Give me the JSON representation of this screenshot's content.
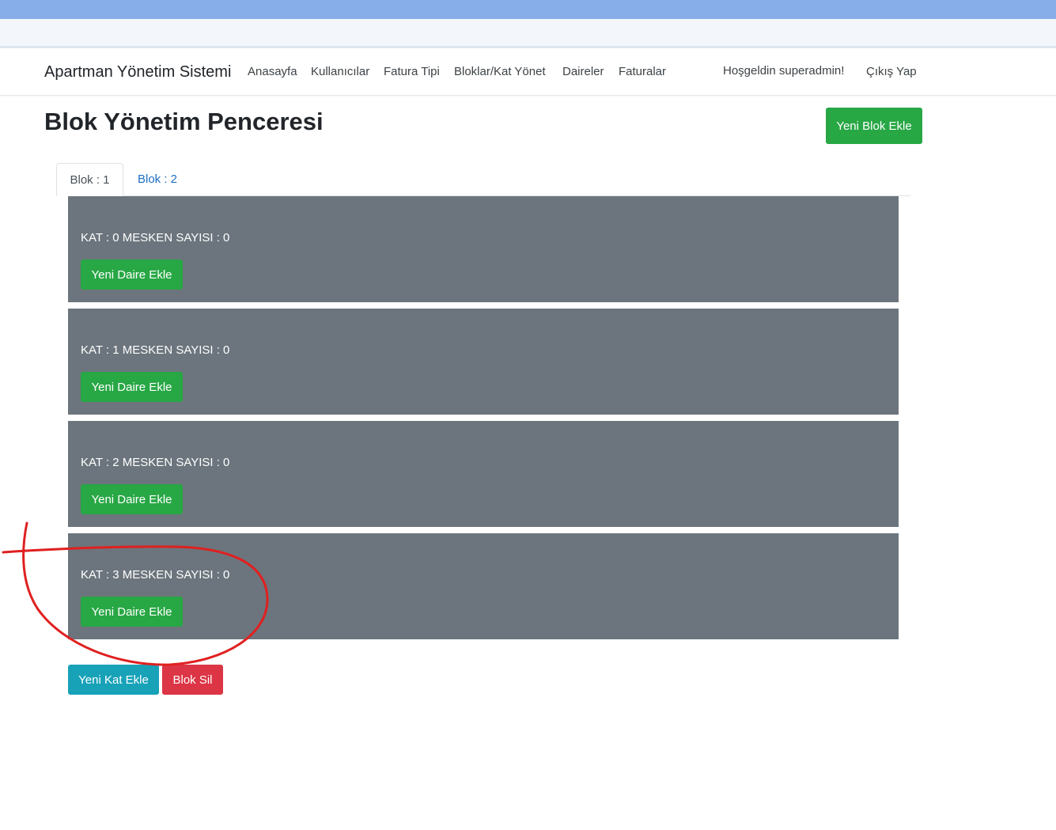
{
  "navbar": {
    "brand": "Apartman Yönetim Sistemi",
    "links": [
      "Anasayfa",
      "Kullanıcılar",
      "Fatura Tipi",
      "Bloklar/Kat Yönet",
      "Daireler",
      "Faturalar"
    ],
    "welcome": "Hoşgeldin superadmin!",
    "logout": "Çıkış Yap"
  },
  "page": {
    "title": "Blok Yönetim Penceresi",
    "new_block_label": "Yeni Blok Ekle"
  },
  "tabs": [
    {
      "label": "Blok : 1",
      "active": true
    },
    {
      "label": "Blok : 2",
      "active": false
    }
  ],
  "floors": [
    {
      "label": "KAT : 0 MESKEN SAYISI : 0",
      "button": "Yeni Daire Ekle"
    },
    {
      "label": "KAT : 1 MESKEN SAYISI : 0",
      "button": "Yeni Daire Ekle"
    },
    {
      "label": "KAT : 2 MESKEN SAYISI : 0",
      "button": "Yeni Daire Ekle"
    },
    {
      "label": "KAT : 3 MESKEN SAYISI : 0",
      "button": "Yeni Daire Ekle"
    }
  ],
  "actions": {
    "add_floor": "Yeni Kat Ekle",
    "delete_block": "Blok Sil"
  },
  "colors": {
    "success": "#28a745",
    "info": "#17a2b8",
    "danger": "#dc3545",
    "card": "#6c757d",
    "annotation": "#e02020"
  }
}
